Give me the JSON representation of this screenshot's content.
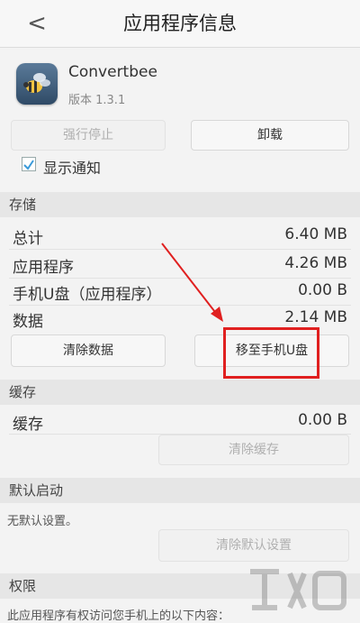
{
  "header": {
    "back_glyph": "<",
    "title": "应用程序信息"
  },
  "app": {
    "name": "Convertbee",
    "version": "版本 1.3.1",
    "icon": "bee-app-icon"
  },
  "buttons": {
    "force_stop": "强行停止",
    "uninstall": "卸载"
  },
  "notification": {
    "label": "显示通知",
    "checked": true
  },
  "storage": {
    "title": "存储",
    "rows": [
      {
        "label": "总计",
        "value": "6.40 MB"
      },
      {
        "label": "应用程序",
        "value": "4.26 MB"
      },
      {
        "label": "手机U盘（应用程序）",
        "value": "0.00 B"
      },
      {
        "label": "数据",
        "value": "2.14 MB"
      }
    ],
    "clear_data": "清除数据",
    "move_to_usb": "移至手机U盘"
  },
  "cache": {
    "title": "缓存",
    "label": "缓存",
    "value": "0.00 B",
    "clear_cache": "清除缓存"
  },
  "default_launch": {
    "title": "默认启动",
    "text": "无默认设置。",
    "clear_defaults": "清除默认设置"
  },
  "permissions": {
    "title": "权限",
    "text": "此应用程序有权访问您手机上的以下内容："
  },
  "annotation": {
    "color": "#e02020"
  }
}
